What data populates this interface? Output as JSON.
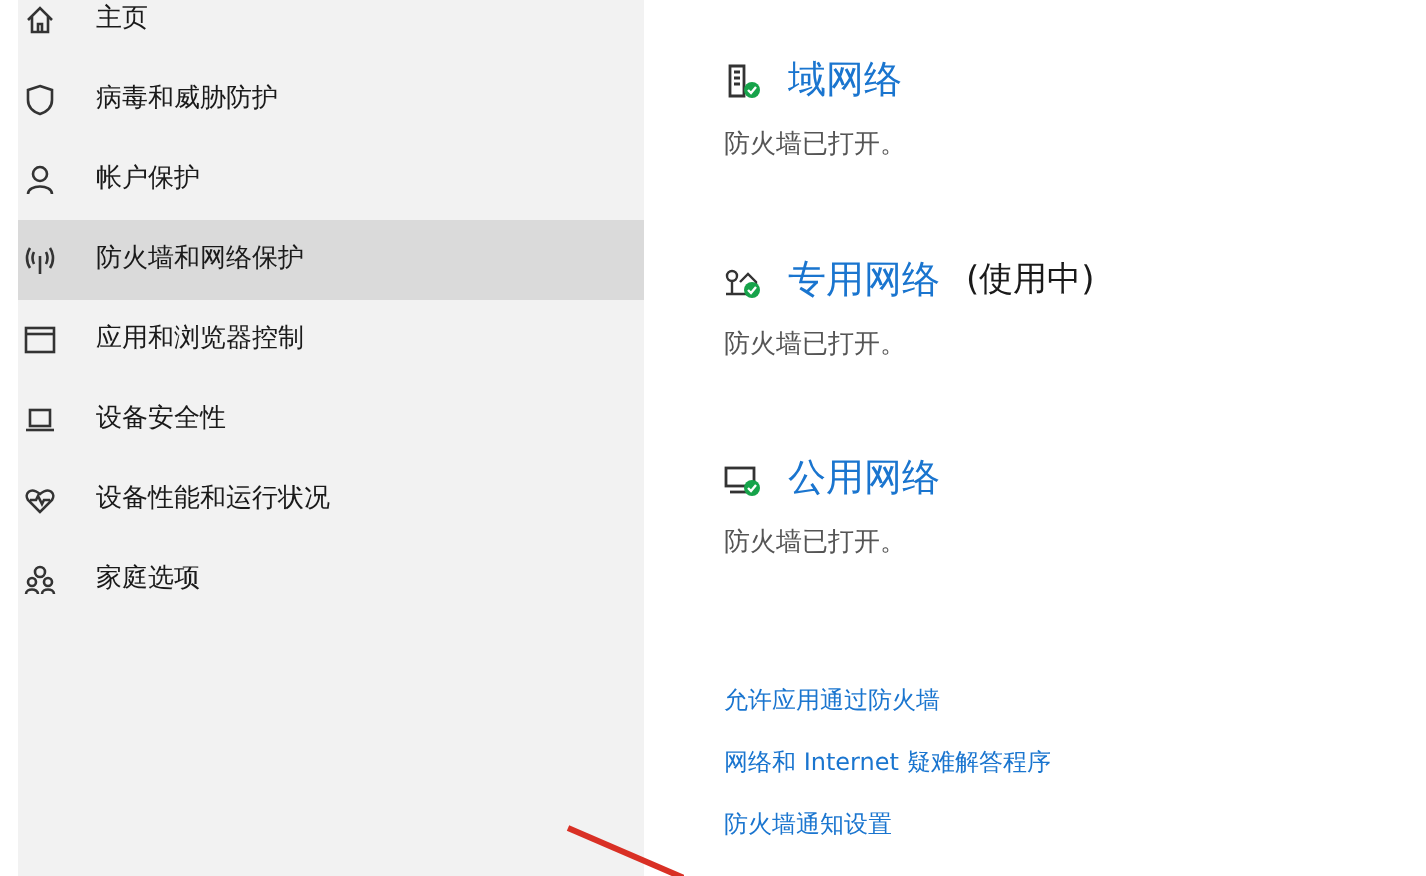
{
  "sidebar": {
    "items": [
      {
        "label": "主页",
        "kind": "home",
        "selected": false
      },
      {
        "label": "病毒和威胁防护",
        "kind": "shield",
        "selected": false
      },
      {
        "label": "帐户保护",
        "kind": "person",
        "selected": false
      },
      {
        "label": "防火墙和网络保护",
        "kind": "antenna",
        "selected": true
      },
      {
        "label": "应用和浏览器控制",
        "kind": "window",
        "selected": false
      },
      {
        "label": "设备安全性",
        "kind": "laptop",
        "selected": false
      },
      {
        "label": "设备性能和运行状况",
        "kind": "heart",
        "selected": false
      },
      {
        "label": "家庭选项",
        "kind": "family",
        "selected": false
      }
    ]
  },
  "networks": [
    {
      "kind": "domain",
      "title": "域网络",
      "status": "防火墙已打开。"
    },
    {
      "kind": "private",
      "title": "专用网络",
      "note": "(使用中)",
      "status": "防火墙已打开。"
    },
    {
      "kind": "public",
      "title": "公用网络",
      "status": "防火墙已打开。"
    }
  ],
  "links": [
    "允许应用通过防火墙",
    "网络和 Internet 疑难解答程序",
    "防火墙通知设置"
  ]
}
